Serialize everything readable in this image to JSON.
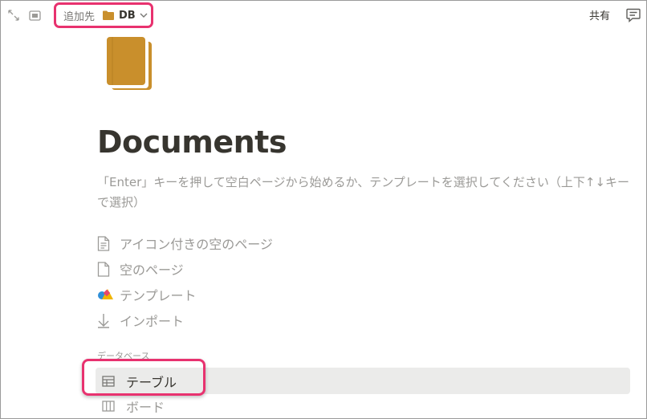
{
  "topbar": {
    "expand_icon": "expand-arrows-icon",
    "panel_icon": "side-panel-icon",
    "add_to_label": "追加先",
    "add_to_db": "DB",
    "share_label": "共有",
    "comment_icon": "comment-icon"
  },
  "page": {
    "icon": "book-icon",
    "icon_color": "#c98f2c",
    "title": "Documents",
    "hint": "「Enter」キーを押して空白ページから始めるか、テンプレートを選択してください（上下↑↓キーで選択）"
  },
  "options": [
    {
      "label": "アイコン付きの空のページ",
      "icon": "document-lines-icon"
    },
    {
      "label": "空のページ",
      "icon": "document-icon"
    },
    {
      "label": "テンプレート",
      "icon": "template-shapes-icon"
    },
    {
      "label": "インポート",
      "icon": "download-arrow-icon"
    }
  ],
  "database": {
    "section_label": "データベース",
    "items": [
      {
        "label": "テーブル",
        "icon": "table-icon"
      },
      {
        "label": "ボード",
        "icon": "board-icon"
      }
    ]
  },
  "colors": {
    "highlight": "#e8326f",
    "selected_bg": "#ebebea",
    "muted_text": "#9b9a97",
    "main_text": "#37352f"
  }
}
